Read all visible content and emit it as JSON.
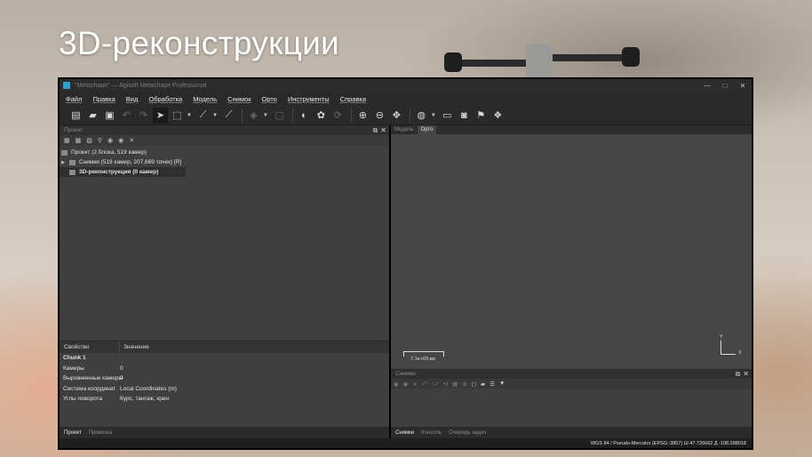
{
  "slide": {
    "title": "3D-реконструкции"
  },
  "window": {
    "title": "\"Metashape\" — Agisoft Metashape Professional",
    "controls": [
      "—",
      "□",
      "✕"
    ]
  },
  "menu": [
    "Файл",
    "Правка",
    "Вид",
    "Обработка",
    "Модель",
    "Снимок",
    "Орто",
    "Инструменты",
    "Справка"
  ],
  "toolbar": {
    "icons": [
      "new-file-icon",
      "open-folder-icon",
      "save-icon",
      "undo-icon",
      "redo-icon",
      "select-pointer-icon",
      "rectangle-select-icon",
      "polyline-icon",
      "ruler-icon",
      "paint-bucket-icon",
      "crop-icon",
      "contrast-icon",
      "palette-icon",
      "rotate-icon",
      "zoom-in-icon",
      "zoom-out-icon",
      "move-icon",
      "globe-icon",
      "panel-icon",
      "camera-icon",
      "flag-icon",
      "heart-map-icon"
    ]
  },
  "project_panel": {
    "header": "Проект",
    "tree": [
      {
        "label": "Проект (2 блока, 519 камер)",
        "level": 0,
        "selected": false
      },
      {
        "label": "Снимки (519 камер, 207,669 точек) [R]",
        "level": 1,
        "selected": false
      },
      {
        "label": "3D-реконструкция (0 камер)",
        "level": 1,
        "selected": true
      }
    ]
  },
  "properties": {
    "col_property": "Свойство",
    "col_value": "Значение",
    "rows": [
      {
        "key": "Chunk 1",
        "value": ""
      },
      {
        "key": "Камеры",
        "value": "0"
      },
      {
        "key": "Выровненные камеры",
        "value": "0"
      },
      {
        "key": "Система координат",
        "value": "Local Coordinates (m)"
      },
      {
        "key": "Углы поворота",
        "value": "Курс, тангаж, крен"
      }
    ]
  },
  "left_bottom_tabs": [
    "Проект",
    "Привязка"
  ],
  "view_tabs": [
    "Модель",
    "Орто"
  ],
  "viewport": {
    "scale_label": "7.1e+03 км",
    "axis_y": "Y",
    "axis_x": "X"
  },
  "photos_panel": {
    "header": "Снимки"
  },
  "right_bottom_tabs": [
    "Снимки",
    "Консоль",
    "Очередь задач"
  ],
  "status": {
    "text": "WGS 84 / Pseudo-Mercator (EPSG::3857)  Ш 47.726662  Д -108.288018"
  }
}
